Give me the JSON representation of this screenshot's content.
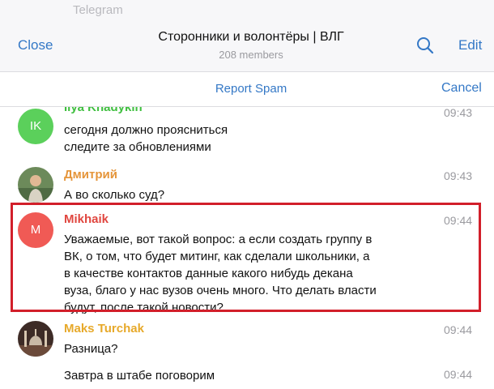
{
  "status_bar": {
    "app_name": "Telegram"
  },
  "nav": {
    "close_label": "Close",
    "title": "Сторонники и волонтёры | ВЛГ",
    "subtitle": "208 members",
    "search_icon": "search-icon",
    "edit_label": "Edit"
  },
  "spam_bar": {
    "report_label": "Report Spam",
    "cancel_label": "Cancel"
  },
  "colors": {
    "accent": "#3478c6",
    "highlight_border": "#d21f2a",
    "sender_ik": "#3fbf3f",
    "sender_dmitry": "#e5953a",
    "sender_mikhaik": "#e0463f",
    "sender_maks": "#e7a92a"
  },
  "messages": [
    {
      "sender": "Ilya Khadykin",
      "initials": "IK",
      "avatar_color": "#5bd05b",
      "lines": [
        "сегодня должно проясниться",
        "следите за обновлениями"
      ],
      "time": "09:43"
    },
    {
      "sender": "Дмитрий",
      "avatar": "photo-avatar",
      "lines": [
        "А во сколько суд?"
      ],
      "time": "09:43"
    },
    {
      "sender": "Mikhaik",
      "initials": "M",
      "avatar_color": "#f05a55",
      "lines": [
        "Уважаемые, вот такой вопрос: а если создать группу в",
        "ВК, о том, что будет митинг, как сделали школьники, а",
        "в качестве контактов данные какого нибудь декана",
        "вуза, благо у нас вузов очень много. Что делать власти",
        "будут, после такой новости?"
      ],
      "time": "09:44"
    },
    {
      "sender": "Maks Turchak",
      "avatar": "mosque-photo-avatar",
      "lines": [
        "Разница?"
      ],
      "time": "09:44"
    },
    {
      "lines": [
        "Завтра в штабе поговорим"
      ],
      "time": "09:44"
    }
  ]
}
